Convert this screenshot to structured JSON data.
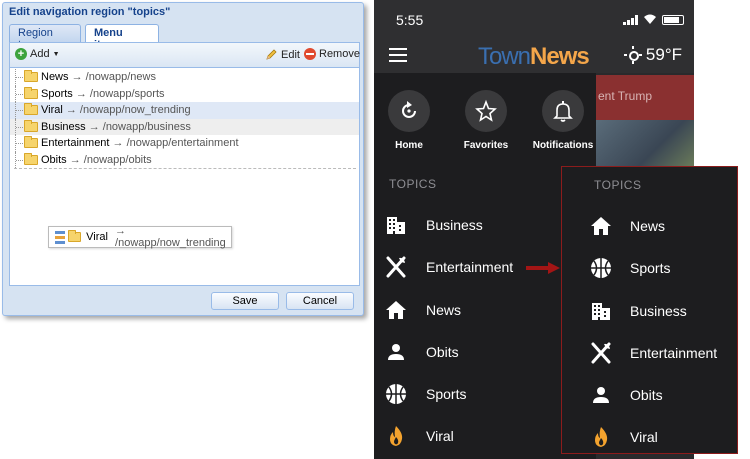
{
  "dialog": {
    "title": "Edit navigation region \"topics\"",
    "tabs": [
      {
        "label": "Region type",
        "active": false
      },
      {
        "label": "Menu items",
        "active": true
      }
    ],
    "toolbar": {
      "add_label": "Add",
      "edit_label": "Edit",
      "remove_label": "Remove"
    },
    "tree_items": [
      {
        "name": "News",
        "path": "→ /nowapp/news",
        "state": "normal"
      },
      {
        "name": "Sports",
        "path": "→ /nowapp/sports",
        "state": "normal"
      },
      {
        "name": "Viral",
        "path": "→ /nowapp/now_trending",
        "state": "selected"
      },
      {
        "name": "Business",
        "path": "→ /nowapp/business",
        "state": "hover"
      },
      {
        "name": "Entertainment",
        "path": "→ /nowapp/entertainment",
        "state": "normal"
      },
      {
        "name": "Obits",
        "path": "→ /nowapp/obits",
        "state": "normal"
      }
    ],
    "drag_proxy": {
      "name": "Viral",
      "path": "→ /nowapp/now_trending"
    },
    "save_label": "Save",
    "cancel_label": "Cancel"
  },
  "phone": {
    "time": "5:55",
    "logo_part1": "Town",
    "logo_part2": "News",
    "temperature": "59°F",
    "background_headline": "ent Trump",
    "quick_actions": [
      {
        "label": "Home",
        "icon": "refresh-icon"
      },
      {
        "label": "Favorites",
        "icon": "star-icon"
      },
      {
        "label": "Notifications",
        "icon": "bell-icon"
      }
    ],
    "topics_title": "TOPICS",
    "topics_before": [
      {
        "label": "Business",
        "icon": "building-icon"
      },
      {
        "label": "Entertainment",
        "icon": "fork-knife-icon"
      },
      {
        "label": "News",
        "icon": "home-icon"
      },
      {
        "label": "Obits",
        "icon": "person-icon"
      },
      {
        "label": "Sports",
        "icon": "basketball-icon"
      },
      {
        "label": "Viral",
        "icon": "flame-icon"
      }
    ],
    "topics_after_title": "TOPICS",
    "topics_after": [
      {
        "label": "News",
        "icon": "home-icon"
      },
      {
        "label": "Sports",
        "icon": "basketball-icon"
      },
      {
        "label": "Business",
        "icon": "building-icon"
      },
      {
        "label": "Entertainment",
        "icon": "fork-knife-icon"
      },
      {
        "label": "Obits",
        "icon": "person-icon"
      },
      {
        "label": "Viral",
        "icon": "flame-icon"
      }
    ]
  },
  "colors": {
    "dialog_title": "#15428b",
    "selection": "#dfe8f6",
    "logo_town": "#3a6fb0",
    "logo_news": "#f4a64a",
    "flame": "#f4a32e",
    "highlight_border": "#8c1c1c",
    "arrow": "#a31515"
  }
}
